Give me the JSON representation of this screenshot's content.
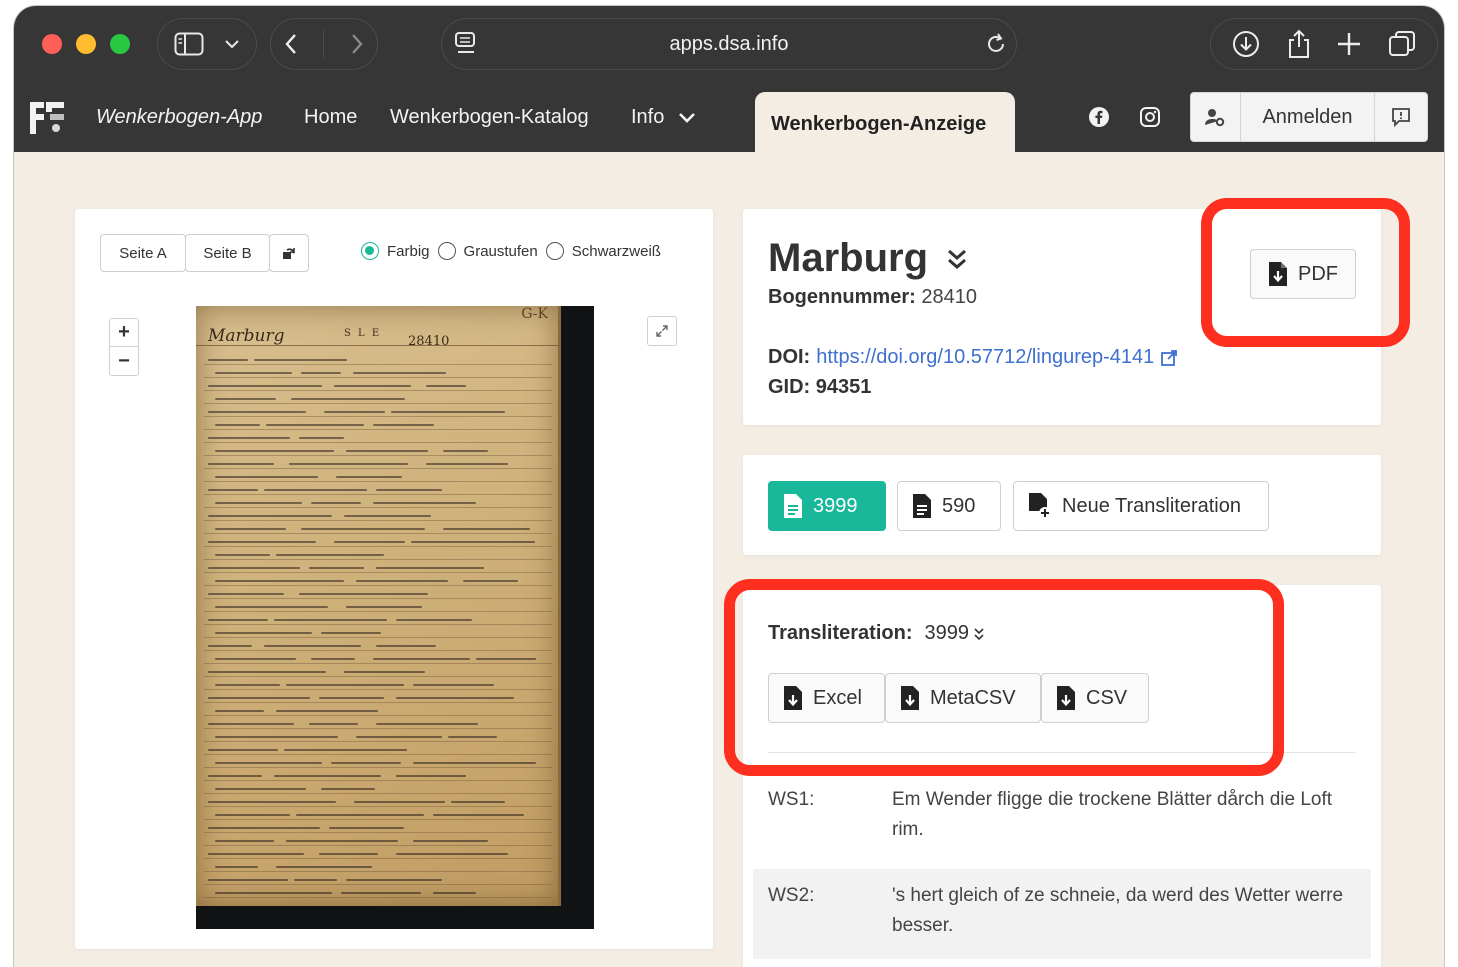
{
  "browser": {
    "url": "apps.dsa.info"
  },
  "nav": {
    "brand": "Wenkerbogen-App",
    "home": "Home",
    "katalog": "Wenkerbogen-Katalog",
    "info": "Info",
    "active_tab": "Wenkerbogen-Anzeige",
    "login": "Anmelden"
  },
  "viewer": {
    "seite_a": "Seite A",
    "seite_b": "Seite B",
    "modes": [
      "Farbig",
      "Graustufen",
      "Schwarzweiß"
    ],
    "selected_mode": "Farbig",
    "zoom_in": "+",
    "zoom_out": "−"
  },
  "scan": {
    "corner_label": "G-K",
    "place": "Marburg",
    "number": "28410",
    "sle": "S L E",
    "handwritten_lines": 42
  },
  "record": {
    "title": "Marburg",
    "bogennummer_label": "Bogennummer:",
    "bogennummer": "28410",
    "doi_label": "DOI:",
    "doi": "https://doi.org/10.57712/lingurep-4141",
    "gid_label": "GID:",
    "gid": "94351",
    "pdf_label": "PDF"
  },
  "transliterations": {
    "active": "3999",
    "other": "590",
    "new_label": "Neue Transliteration"
  },
  "downloads": {
    "label": "Transliteration:",
    "selected": "3999",
    "excel": "Excel",
    "metacsv": "MetaCSV",
    "csv": "CSV"
  },
  "sentences": [
    {
      "key": "WS1:",
      "text": "Em Wender fligge die trockene Blätter dårch die Loft rim."
    },
    {
      "key": "WS2:",
      "text": "'s hert gleich of ze schneie, da werd des Wetter werre besser."
    }
  ],
  "colors": {
    "accent": "#19b89b",
    "highlight": "#ff2f1f",
    "link": "#3f6fd1",
    "background": "#f4ede3",
    "chrome": "#363636"
  }
}
